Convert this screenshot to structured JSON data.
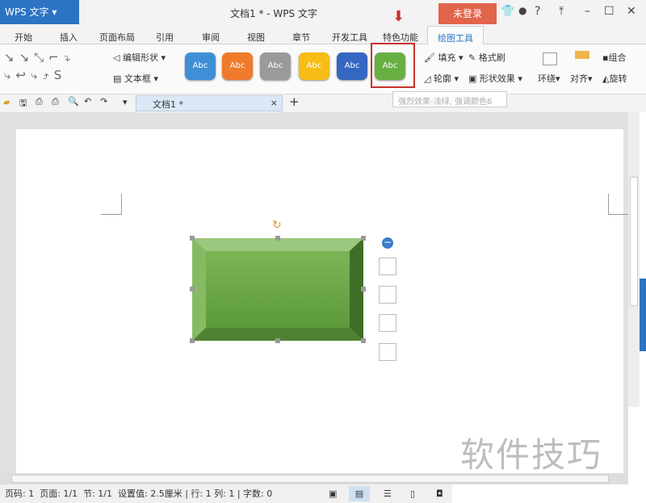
{
  "app": {
    "name": "WPS 文字",
    "title": "文档1 * - WPS 文字",
    "login": "未登录",
    "help": "?"
  },
  "tabs": [
    "开始",
    "插入",
    "页面布局",
    "引用",
    "审阅",
    "视图",
    "章节",
    "开发工具",
    "特色功能",
    "绘图工具"
  ],
  "ribbon": {
    "edit_shape": "编辑形状",
    "text_box": "文本框",
    "styles": [
      {
        "label": "Abc",
        "color": "#3f8fd6"
      },
      {
        "label": "Abc",
        "color": "#ef7a2b"
      },
      {
        "label": "Abc",
        "color": "#9a9a9a"
      },
      {
        "label": "Abc",
        "color": "#f7bd15"
      },
      {
        "label": "Abc",
        "color": "#3566c1"
      },
      {
        "label": "Abc",
        "color": "#68b043"
      }
    ],
    "fill": "填充",
    "format_painter": "格式刷",
    "outline": "轮廓",
    "shape_effect": "形状效果",
    "wrap": "环绕",
    "align": "对齐",
    "group": "组合",
    "rotate": "旋转"
  },
  "tooltip": "强烈效果-浅绿, 强调颜色6",
  "doc_tab": "文档1 *",
  "status": {
    "page_num": "页码: 1",
    "pages": "页面: 1/1",
    "section": "节: 1/1",
    "setting": "设置值: 2.5厘米",
    "row": "行: 1",
    "col": "列: 1",
    "words": "字数: 0"
  },
  "watermark": "软件技巧"
}
